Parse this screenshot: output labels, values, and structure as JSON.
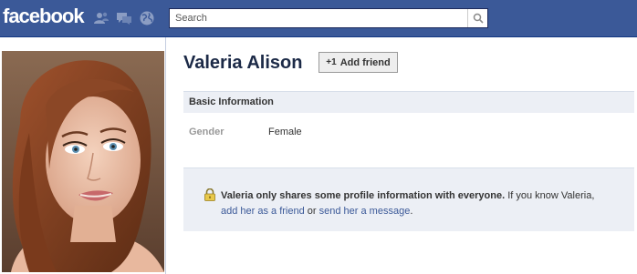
{
  "brand": {
    "logo_text": "facebook"
  },
  "topbar": {
    "icons": [
      "friend-requests-icon",
      "messages-icon",
      "notifications-icon"
    ],
    "search": {
      "placeholder": "Search",
      "value": ""
    }
  },
  "profile": {
    "name": "Valeria Alison",
    "add_friend_label": "Add friend",
    "add_friend_icon": "+1"
  },
  "basic_info": {
    "header": "Basic Information",
    "fields": [
      {
        "label": "Gender",
        "value": "Female"
      }
    ]
  },
  "privacy_notice": {
    "bold_text": "Valeria only shares some profile information with everyone.",
    "text_1": " If you know Valeria,",
    "link_add": "add her as a friend",
    "text_2": " or ",
    "link_message": "send her a message",
    "text_3": "."
  },
  "colors": {
    "brand_blue": "#3b5998",
    "panel_bg": "#eceff5",
    "name_color": "#1c2a47"
  }
}
